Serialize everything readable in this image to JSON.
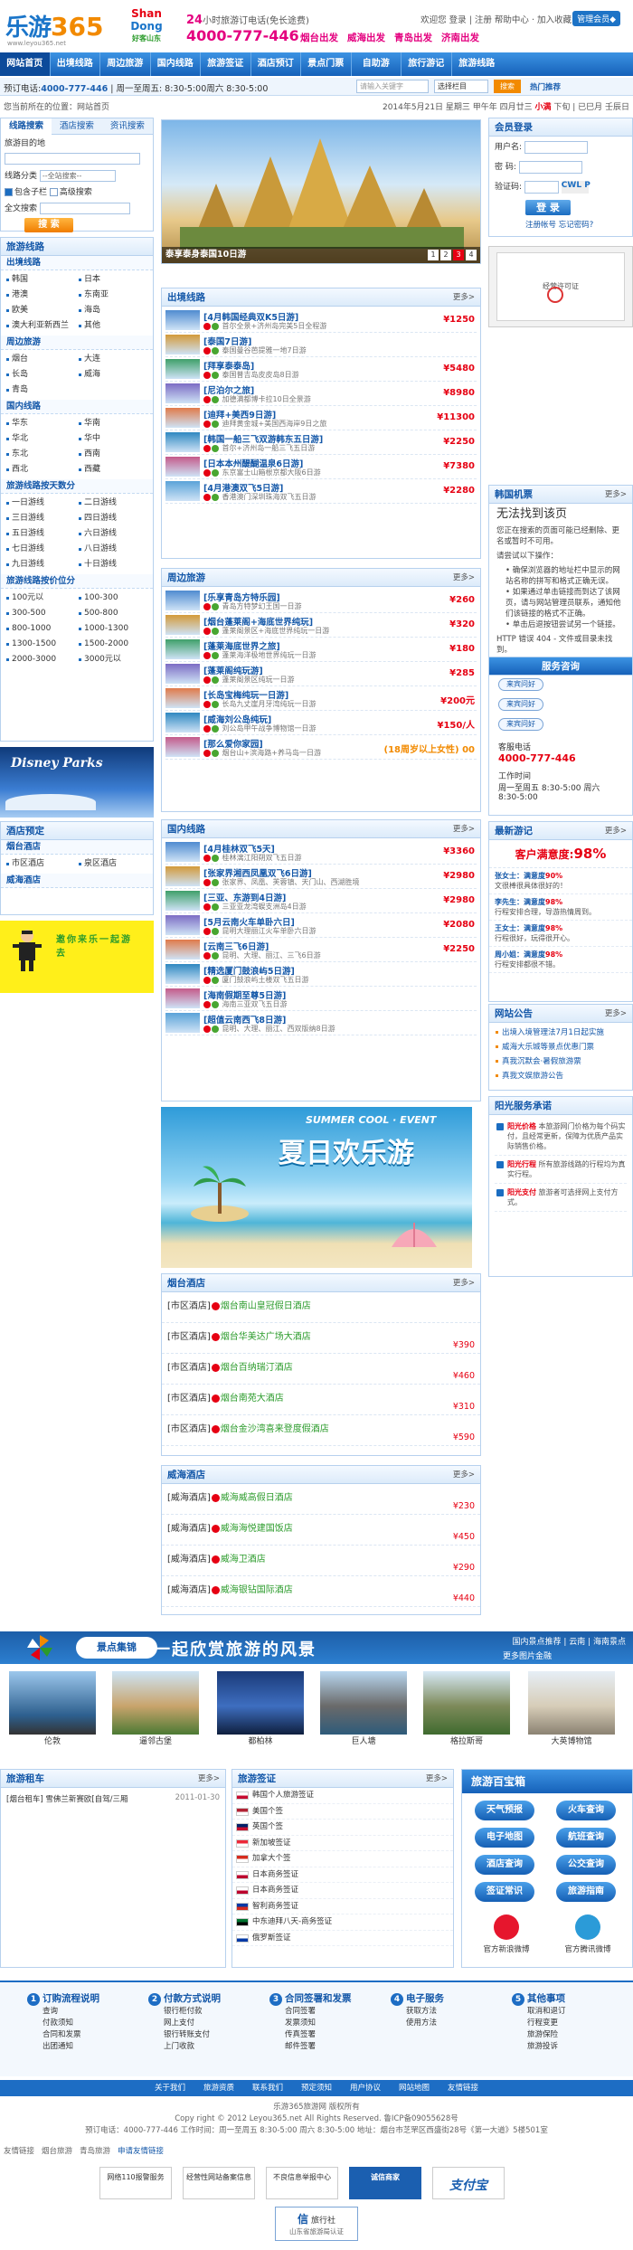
{
  "header": {
    "logo_text": "乐游",
    "logo_num": "365",
    "logo_sub": "www.leyou365.net",
    "sd_logo_1": "Shan",
    "sd_logo_2": "Dong",
    "sd_logo_3": "好客山东",
    "hotline_label_prefix": "24",
    "hotline_label": "小时旅游订电话(免长途费)",
    "hotline": "4000-777-446",
    "cities": [
      "烟台出发",
      "威海出发",
      "青岛出发",
      "济南出发"
    ],
    "top_links": "欢迎您  登录 | 注册  帮助中心 · 加入收藏",
    "top_button": "管理会员◆"
  },
  "nav": [
    "网站首页",
    "出境线路",
    "周边旅游",
    "国内线路",
    "旅游签证",
    "酒店预订",
    "景点门票",
    "自助游",
    "旅行游记",
    "旅游线路"
  ],
  "subbar": {
    "left_prefix": "预订电话:",
    "left_phone": "4000-777-446",
    "left_hours": " | 周一至周五: 8:30-5:00周六 8:30-5:00",
    "search_placeholder": "请输入关键字",
    "search_select": "选择栏目",
    "search_button": "搜索",
    "right": "热门推荐"
  },
  "crumb": {
    "left": "您当前所在的位置：网站首页",
    "right_date": "2014年5月21日 星期三  甲午年 四月廿三 ",
    "right_highlight": "小满",
    "right_tail": " 下旬 | 已巳月 壬辰日"
  },
  "search_panel": {
    "tabs": [
      "线路搜索",
      "酒店搜索",
      "资讯搜索"
    ],
    "dest_label": "旅游目的地",
    "type_label": "线路分类",
    "type_value": "--全站搜索--",
    "opt1": "包含子栏",
    "opt2": "高级搜索",
    "full_label": "全文搜索",
    "button": "搜 索"
  },
  "left_routes": {
    "title": "旅游线路",
    "groups": [
      {
        "name": "出境线路",
        "items": [
          "韩国",
          "日本",
          "港澳",
          "东南亚",
          "欧美",
          "海岛",
          "澳大利亚新西兰",
          "其他"
        ]
      },
      {
        "name": "周边旅游",
        "items": [
          "烟台",
          "大连",
          "长岛",
          "威海",
          "青岛"
        ]
      },
      {
        "name": "国内线路",
        "items": [
          "华东",
          "华南",
          "华北",
          "华中",
          "东北",
          "西南",
          "西北",
          "西藏"
        ]
      },
      {
        "name": "旅游线路按天数分",
        "items": [
          "一日游线",
          "二日游线",
          "三日游线",
          "四日游线",
          "五日游线",
          "六日游线",
          "七日游线",
          "八日游线",
          "九日游线",
          "十日游线"
        ]
      },
      {
        "name": "旅游线路按价位分",
        "items": [
          "100元以",
          "100-300",
          "300-500",
          "500-800",
          "800-1000",
          "1000-1300",
          "1300-1500",
          "1500-2000",
          "2000-3000",
          "3000元以"
        ]
      }
    ]
  },
  "disney_text": "Disney Parks",
  "hotel_panel": {
    "title": "酒店预定",
    "groups": [
      {
        "name": "烟台酒店",
        "items": [
          "市区酒店",
          "泉区酒店"
        ]
      },
      {
        "name": "威海酒店",
        "items": []
      }
    ]
  },
  "psy_banner": "邀你来乐一起游去",
  "slide": {
    "caption": "泰享泰身泰国10日游",
    "pages": [
      "1",
      "2",
      "3",
      "4"
    ]
  },
  "outbound": {
    "title": "出境线路",
    "more": "更多>",
    "items": [
      {
        "name": "[4月韩国经典双K5日游]",
        "desc": "首尔全景+济州岛完美5日全程游",
        "price": "¥1250"
      },
      {
        "name": "[泰国7日游]",
        "desc": "泰国曼谷芭提雅一地7日游",
        "price": ""
      },
      {
        "name": "[拜享泰泰岛]",
        "desc": "泰国普吉岛皮皮岛8日游",
        "price": "¥5480"
      },
      {
        "name": "[尼泊尔之旅]",
        "desc": "加德满都博卡拉10日全景游",
        "price": "¥8980"
      },
      {
        "name": "[迪拜+美西9日游]",
        "desc": "迪拜黄金城+美国西海岸9日之旅",
        "price": "¥11300"
      },
      {
        "name": "[韩国一船三飞双游韩东五日游]",
        "desc": "首尔+济州岛一船三飞五日游",
        "price": "¥2250"
      },
      {
        "name": "[日本本州醍醐温泉6日游]",
        "desc": "东京富士山箱根京都大阪6日游",
        "price": "¥7380"
      },
      {
        "name": "[4月港澳双飞5日游]",
        "desc": "香港澳门深圳珠海双飞五日游",
        "price": "¥2280"
      }
    ]
  },
  "nearby": {
    "title": "周边旅游",
    "more": "更多>",
    "items": [
      {
        "name": "[乐享青岛方特乐园]",
        "desc": "青岛方特梦幻王国一日游",
        "price": "¥260"
      },
      {
        "name": "[烟台蓬莱阁+海底世界纯玩]",
        "desc": "蓬莱阁景区+海底世界纯玩一日游",
        "price": "¥320"
      },
      {
        "name": "[蓬莱海底世界之旅]",
        "desc": "蓬莱海洋极地世界纯玩一日游",
        "price": "¥180"
      },
      {
        "name": "[蓬莱阁纯玩游]",
        "desc": "蓬莱阁景区纯玩一日游",
        "price": "¥285"
      },
      {
        "name": "[长岛宝梅纯玩一日游]",
        "desc": "长岛九丈崖月牙湾纯玩一日游",
        "price": "¥200元"
      },
      {
        "name": "[威海刘公岛纯玩]",
        "desc": "刘公岛甲午战争博物馆一日游",
        "price": "¥150/人"
      },
      {
        "name": "[那么爱你家园]",
        "desc": "烟台山+滨海路+养马岛一日游",
        "price": "(18周岁以上女性) 00"
      }
    ]
  },
  "domestic": {
    "title": "国内线路",
    "more": "更多>",
    "items": [
      {
        "name": "[4月桂林双飞5天]",
        "desc": "桂林漓江阳朔双飞五日游",
        "price": "¥3360"
      },
      {
        "name": "[张家界湘西凤凰双飞6日游]",
        "desc": "张家界、凤凰、芙蓉镇、天门山、西湖胜境",
        "price": "¥2980"
      },
      {
        "name": "[三亚、东游到4日游]",
        "desc": "三亚亚龙湾蜈支洲岛4日游",
        "price": "¥2980"
      },
      {
        "name": "[5月云南火车单卧六日]",
        "desc": "昆明大理丽江火车单卧六日游",
        "price": "¥2080"
      },
      {
        "name": "[云南三飞6日游]",
        "desc": "昆明、大理、丽江、三飞6日游",
        "price": "¥2250"
      },
      {
        "name": "[精选厦门鼓浪屿5日游]",
        "desc": "厦门鼓浪屿土楼双飞五日游",
        "price": ""
      },
      {
        "name": "[海南假期至尊5日游]",
        "desc": "海南三亚双飞五日游",
        "price": ""
      },
      {
        "name": "[超值云南西飞8日游]",
        "desc": "昆明、大理、丽江、西双版纳8日游",
        "price": ""
      }
    ]
  },
  "summer_banner": {
    "tagline": "SUMMER COOL · EVENT",
    "title": "夏日欢乐游"
  },
  "yantai_hotels": {
    "title": "烟台酒店",
    "more": "更多>",
    "items": [
      {
        "tag": "[市区酒店]",
        "name": "烟台南山皇冠假日酒店",
        "price": ""
      },
      {
        "tag": "[市区酒店]",
        "name": "烟台华美达广场大酒店",
        "price": "¥390"
      },
      {
        "tag": "[市区酒店]",
        "name": "烟台百纳瑞汀酒店",
        "price": "¥460"
      },
      {
        "tag": "[市区酒店]",
        "name": "烟台南苑大酒店",
        "price": "¥310"
      },
      {
        "tag": "[市区酒店]",
        "name": "烟台金沙湾喜来登度假酒店",
        "price": "¥590"
      }
    ]
  },
  "weihai_hotels": {
    "title": "威海酒店",
    "more": "更多>",
    "items": [
      {
        "tag": "[威海酒店]",
        "name": "威海威高假日酒店",
        "price": "¥230"
      },
      {
        "tag": "[威海酒店]",
        "name": "威海海悦建国饭店",
        "price": "¥450"
      },
      {
        "tag": "[威海酒店]",
        "name": "威海卫酒店",
        "price": "¥290"
      },
      {
        "tag": "[威海酒店]",
        "name": "威海银钻国际酒店",
        "price": "¥440"
      }
    ]
  },
  "login": {
    "title": "会员登录",
    "user_label": "用户名:",
    "pwd_label": "密  码:",
    "code_label": "验证码:",
    "code": "CWL P",
    "button": "登 录",
    "register": "注册帐号",
    "forgot": "忘记密码?"
  },
  "cert_text": "经营许可证",
  "korea_ticket": {
    "title": "韩国机票",
    "more": "更多>",
    "msg_big": "无法找到该页",
    "msg_1": "您正在搜索的页面可能已经删除、更名或暂时不可用。",
    "msg_2": "请尝试以下操作：",
    "tips": [
      "确保浏览器的地址栏中显示的网站名称的拼写和格式正确无误。",
      "如果通过单击链接而到达了该网页，请与网站管理员联系，通知他们该链接的格式不正确。",
      "单击后退按钮尝试另一个链接。"
    ],
    "err": "HTTP 错误 404 - 文件或目录未找到。"
  },
  "service": {
    "title": "服务咨询",
    "qq": [
      "来宾问好",
      "来宾问好",
      "来宾问好"
    ],
    "tel_label": "客服电话",
    "tel": "4000-777-446",
    "hours_label": "工作时间",
    "hours": "周一至周五 8:30-5:00 周六 8:30-5:00"
  },
  "comments": {
    "title": "最新游记",
    "more": "更多>",
    "sat_label": "客户满意度:",
    "sat_value": "98%",
    "items": [
      {
        "who": "张女士：满意度",
        "pct": "90%",
        "text": "文很棒很具体很好的！"
      },
      {
        "who": "李先生：满意度",
        "pct": "98%",
        "text": "行程安排合理，导游热情周到。"
      },
      {
        "who": "王女士：满意度",
        "pct": "98%",
        "text": "行程很好，玩得很开心。"
      },
      {
        "who": "周小姐：满意度",
        "pct": "98%",
        "text": "行程安排都很不错。"
      }
    ]
  },
  "notice": {
    "title": "网站公告",
    "more": "更多>",
    "items": [
      "出境入境管理法7月1日起实施",
      "威海大乐城等景点优惠门票",
      "真我沉默会·暑假旅游票",
      "真我文娱旅游公告"
    ]
  },
  "promise": {
    "title": "阳光服务承诺",
    "items": [
      {
        "head": "阳光价格",
        "text": "本旅游网门价格为每个码实付，且经常更新，保障为优质产品实际销售价格。"
      },
      {
        "head": "阳光行程",
        "text": "所有旅游线路的行程均为真实行程。"
      },
      {
        "head": "阳光支付",
        "text": "旅游者可选择网上支付方式。"
      }
    ]
  },
  "scenic": {
    "title_badge": "景点集锦",
    "slogan": "一起欣赏旅游的风景",
    "right_top": "国内景点推荐 | 云南 | 海南景点",
    "right_bottom": "更多图片金融",
    "items": [
      "伦敦",
      "逼邻古堡",
      "都柏林",
      "巨人塘",
      "格拉斯哥",
      "大英博物馆"
    ]
  },
  "car_rent": {
    "title": "旅游租车",
    "more": "更多>",
    "item": "[烟台租车] 雪佛兰新赛欧[自驾/三厢",
    "date": "2011-01-30"
  },
  "visa": {
    "title": "旅游签证",
    "more": "更多>",
    "items": [
      "韩国个人旅游签证",
      "美国个签",
      "英国个签",
      "新加坡签证",
      "加拿大个签",
      "日本商务签证",
      "日本商务签证",
      "智利商务签证",
      "中东迪拜八天-商务签证",
      "俄罗斯签证"
    ]
  },
  "toolbox": {
    "title": "旅游百宝箱",
    "buttons": [
      "天气预报",
      "火车查询",
      "电子地图",
      "航班查询",
      "酒店查询",
      "公交查询",
      "签证常识",
      "旅游指南"
    ],
    "weibo": [
      "官方新浪微博",
      "官方腾讯微博"
    ]
  },
  "help": [
    {
      "num": "1",
      "title": "订购流程说明",
      "items": [
        "查询",
        "付款须知",
        "合同和发票",
        "出团通知"
      ]
    },
    {
      "num": "2",
      "title": "付款方式说明",
      "items": [
        "银行柜付款",
        "网上支付",
        "银行转账支付",
        "上门收款"
      ]
    },
    {
      "num": "3",
      "title": "合同签署和发票",
      "items": [
        "合同签署",
        "发票须知",
        "传真签署",
        "邮件签署"
      ]
    },
    {
      "num": "4",
      "title": "电子服务",
      "items": [
        "获取方法",
        "使用方法"
      ]
    },
    {
      "num": "5",
      "title": "其他事项",
      "items": [
        "取消和退订",
        "行程变更",
        "旅游保险",
        "旅游投诉"
      ]
    }
  ],
  "foot_nav": [
    "关于我们",
    "旅游资质",
    "联系我们",
    "预定须知",
    "用户协议",
    "网站地图",
    "友情链接"
  ],
  "copy": {
    "line1": "乐游365旅游网 版权所有",
    "line2": "Copy right © 2012 Leyou365.net All Rights Reserved. 鲁ICP备09055628号",
    "line3": "预订电话：4000-777-446  工作时间：周一至周五 8:30-5:00 周六 8:30-5:00  地址：烟台市芝罘区西盛街28号《第一大道》5楼501室"
  },
  "friend_links": [
    "友情链接",
    "烟台旅游",
    "青岛旅游",
    "申请友情链接"
  ],
  "badges": [
    "网络110报警服务",
    "经营性网站备案信息",
    "不良信息举报中心",
    "诚信商家",
    "支付宝"
  ],
  "xin": {
    "brand": "信",
    "name": "旅行社",
    "sub": "山东省旅游局认证"
  }
}
